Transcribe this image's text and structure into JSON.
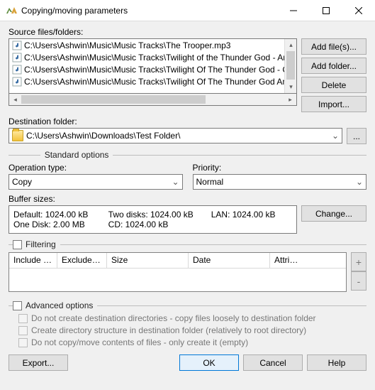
{
  "window": {
    "title": "Copying/moving parameters"
  },
  "source": {
    "label": "Source files/folders:",
    "items": [
      "C:\\Users\\Ashwin\\Music\\Music Tracks\\The Trooper.mp3",
      "C:\\Users\\Ashwin\\Music\\Music Tracks\\Twilight of the Thunder God - Amon Amar",
      "C:\\Users\\Ashwin\\Music\\Music Tracks\\Twilight Of The Thunder God - Corvus Co",
      "C:\\Users\\Ashwin\\Music\\Music Tracks\\Twilight Of The Thunder God Amon - Sab"
    ],
    "buttons": {
      "add_files": "Add file(s)...",
      "add_folder": "Add folder...",
      "delete": "Delete",
      "import": "Import..."
    }
  },
  "destination": {
    "label": "Destination folder:",
    "path": "C:\\Users\\Ashwin\\Downloads\\Test Folder\\",
    "browse": "..."
  },
  "standard": {
    "legend": "Standard options",
    "operation_label": "Operation type:",
    "operation_value": "Copy",
    "priority_label": "Priority:",
    "priority_value": "Normal",
    "buffer_label": "Buffer sizes:",
    "buffer": {
      "default": "Default: 1024.00 kB",
      "two_disks": "Two disks: 1024.00 kB",
      "lan": "LAN: 1024.00 kB",
      "one_disk": "One Disk: 2.00 MB",
      "cd": "CD: 1024.00 kB"
    },
    "change": "Change..."
  },
  "filtering": {
    "legend": "Filtering",
    "cols": {
      "include": "Include …",
      "exclude": "Exclude …",
      "size": "Size",
      "date": "Date",
      "attr": "Attri…"
    },
    "plus": "+",
    "minus": "-"
  },
  "advanced": {
    "legend": "Advanced options",
    "opt1": "Do not create destination directories - copy files loosely to destination folder",
    "opt2": "Create directory structure in destination folder (relatively to root directory)",
    "opt3": "Do not copy/move contents of files - only create it (empty)"
  },
  "bottom": {
    "export": "Export...",
    "ok": "OK",
    "cancel": "Cancel",
    "help": "Help"
  }
}
